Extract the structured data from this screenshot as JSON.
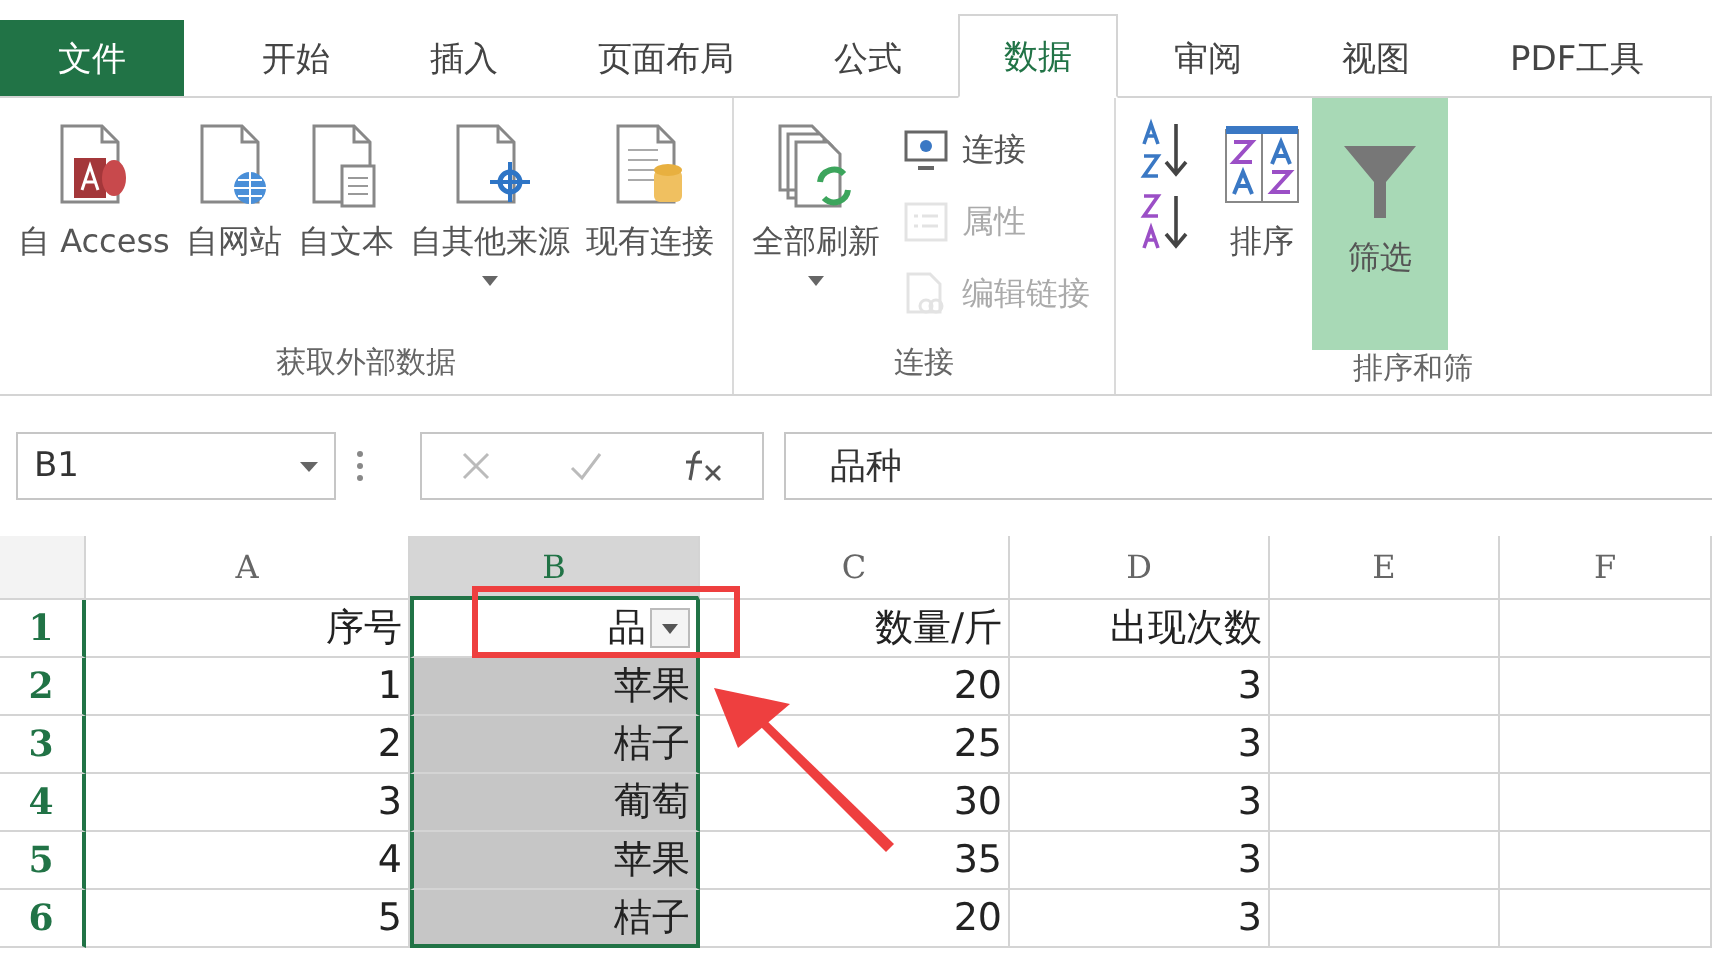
{
  "tabs": [
    {
      "label": "文件",
      "kind": "file",
      "selected": false
    },
    {
      "label": "开始",
      "kind": "tab",
      "selected": false
    },
    {
      "label": "插入",
      "kind": "tab",
      "selected": false
    },
    {
      "label": "页面布局",
      "kind": "tab",
      "selected": false
    },
    {
      "label": "公式",
      "kind": "tab",
      "selected": false
    },
    {
      "label": "数据",
      "kind": "tab",
      "selected": true
    },
    {
      "label": "审阅",
      "kind": "tab",
      "selected": false
    },
    {
      "label": "视图",
      "kind": "tab",
      "selected": false
    },
    {
      "label": "PDF工具",
      "kind": "tab",
      "selected": false
    }
  ],
  "ribbon": {
    "groups": [
      {
        "label": "获取外部数据",
        "buttons": [
          {
            "label": "自 Access",
            "kind": "large",
            "dropdown": false,
            "disabled": false,
            "on": false
          },
          {
            "label": "自网站",
            "kind": "large",
            "dropdown": false,
            "disabled": false,
            "on": false
          },
          {
            "label": "自文本",
            "kind": "large",
            "dropdown": false,
            "disabled": false,
            "on": false
          },
          {
            "label": "自其他来源",
            "kind": "large",
            "dropdown": true,
            "disabled": false,
            "on": false
          },
          {
            "label": "现有连接",
            "kind": "large",
            "dropdown": false,
            "disabled": false,
            "on": false
          }
        ]
      },
      {
        "label": "连接",
        "buttons": [
          {
            "label": "全部刷新",
            "kind": "large",
            "dropdown": true,
            "disabled": false,
            "on": false
          },
          {
            "label": "连接",
            "kind": "small",
            "dropdown": false,
            "disabled": false,
            "on": false
          },
          {
            "label": "属性",
            "kind": "small",
            "dropdown": false,
            "disabled": true,
            "on": false
          },
          {
            "label": "编辑链接",
            "kind": "small",
            "dropdown": false,
            "disabled": true,
            "on": false
          }
        ]
      },
      {
        "label": "排序和筛",
        "buttons": [
          {
            "kind": "small",
            "dropdown": false,
            "disabled": false,
            "on": false
          },
          {
            "kind": "small",
            "dropdown": false,
            "disabled": false,
            "on": false
          },
          {
            "label": "排序",
            "kind": "large",
            "dropdown": false,
            "disabled": false,
            "on": false
          },
          {
            "label": "筛选",
            "kind": "large",
            "dropdown": false,
            "disabled": false,
            "on": true
          }
        ]
      }
    ]
  },
  "formula_bar": {
    "name_box": "B1",
    "formula": "品种"
  },
  "sheet": {
    "columns": [
      {
        "label": "A",
        "selected": false,
        "filter": false
      },
      {
        "label": "B",
        "selected": true,
        "filter": true
      },
      {
        "label": "C",
        "selected": false,
        "filter": false
      },
      {
        "label": "D",
        "selected": false,
        "filter": false
      },
      {
        "label": "E",
        "selected": false,
        "filter": false
      },
      {
        "label": "F",
        "selected": false,
        "filter": false
      }
    ],
    "rows": [
      {
        "number": "1",
        "selected": true,
        "cells": [
          "序号",
          "品",
          "数量/斤",
          "出现次数",
          "",
          ""
        ]
      },
      {
        "number": "2",
        "selected": true,
        "cells": [
          "1",
          "苹果",
          "20",
          "3",
          "",
          ""
        ]
      },
      {
        "number": "3",
        "selected": true,
        "cells": [
          "2",
          "桔子",
          "25",
          "3",
          "",
          ""
        ]
      },
      {
        "number": "4",
        "selected": true,
        "cells": [
          "3",
          "葡萄",
          "30",
          "3",
          "",
          ""
        ]
      },
      {
        "number": "5",
        "selected": true,
        "cells": [
          "4",
          "苹果",
          "35",
          "3",
          "",
          ""
        ]
      },
      {
        "number": "6",
        "selected": true,
        "cells": [
          "5",
          "桔子",
          "20",
          "3",
          "",
          ""
        ]
      }
    ]
  }
}
